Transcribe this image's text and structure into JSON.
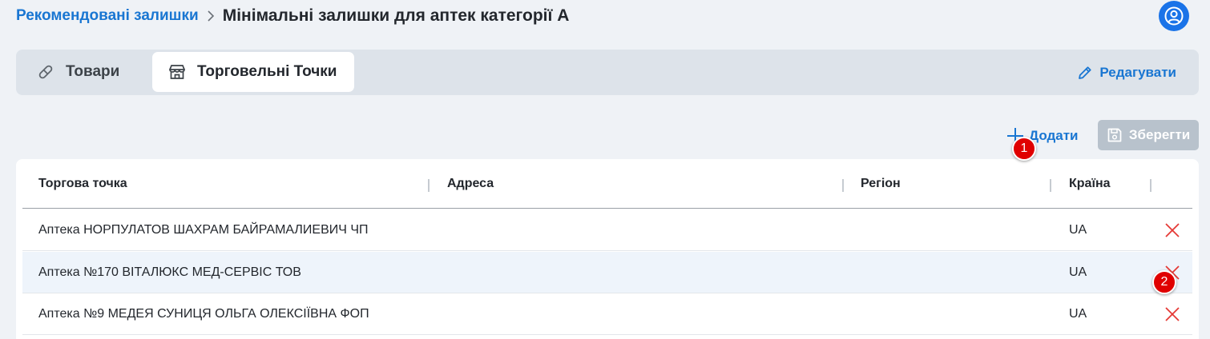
{
  "breadcrumb": {
    "parent": "Рекомендовані залишки",
    "current": "Мінімальні залишки для аптек категорії А"
  },
  "tabs": [
    {
      "label": "Товари",
      "icon": "pill-icon",
      "active": false
    },
    {
      "label": "Торговельні Точки",
      "icon": "store-icon",
      "active": true
    }
  ],
  "actions": {
    "edit_label": "Редагувати",
    "add_label": "Додати",
    "save_label": "Зберегти"
  },
  "badges": {
    "first": "1",
    "second": "2"
  },
  "table": {
    "columns": [
      "Торгова точка",
      "Адреса",
      "Регіон",
      "Країна"
    ],
    "rows": [
      {
        "name": "Аптека НОРПУЛАТОВ ШАХРАМ БАЙРАМАЛИЕВИЧ ЧП",
        "address": "",
        "region": "",
        "country": "UA"
      },
      {
        "name": "Аптека №170 ВІТАЛЮКС МЕД-СЕРВІС ТОВ",
        "address": "",
        "region": "",
        "country": "UA"
      },
      {
        "name": "Аптека №9 МЕДЕЯ СУНИЦЯ ОЛЬГА ОЛЕКСІЇВНА ФОП",
        "address": "",
        "region": "",
        "country": "UA"
      }
    ]
  },
  "colors": {
    "accent": "#1976d2",
    "danger": "#e53935",
    "disabled": "#b8c2cc",
    "badge": "#e00000"
  }
}
